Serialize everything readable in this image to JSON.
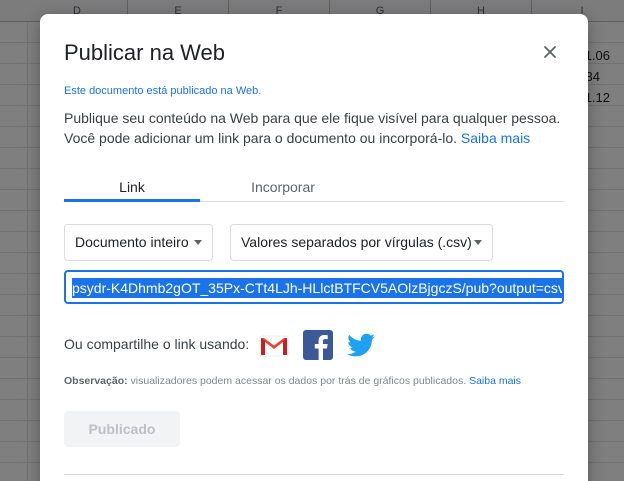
{
  "sheet": {
    "columns": [
      "D",
      "E",
      "F",
      "G",
      "H",
      "I"
    ],
    "cells": [
      {
        "text": "1.06"
      },
      {
        "text": "34"
      },
      {
        "text": "1.12"
      }
    ]
  },
  "dialog": {
    "title": "Publicar na Web",
    "published_note": "Este documento está publicado na Web.",
    "description": "Publique seu conteúdo na Web para que ele fique visível para qualquer pessoa. Você pode adicionar um link para o documento ou incorporá-lo.",
    "description_link": "Saiba mais",
    "tabs": [
      {
        "label": "Link",
        "active": true
      },
      {
        "label": "Incorporar",
        "active": false
      }
    ],
    "document_dropdown": "Documento inteiro",
    "format_dropdown": "Valores separados por vírgulas (.csv)",
    "url_value": "psydr-K4Dhmb2gOT_35Px-CTt4LJh-HLlctBTFCV5AOlzBjgczS/pub?output=csv",
    "share_label": "Ou compartilhe o link usando:",
    "share_icons": [
      "gmail-icon",
      "facebook-icon",
      "twitter-icon"
    ],
    "observation_label": "Observação:",
    "observation_text": " visualizadores podem acessar os dados por trás de gráficos publicados. ",
    "observation_link": "Saiba mais",
    "publish_button": "Publicado"
  },
  "colors": {
    "accent": "#1a73e8",
    "gmail_red": "#ea4335",
    "facebook_blue": "#3b5998",
    "twitter_blue": "#1da1f2"
  }
}
